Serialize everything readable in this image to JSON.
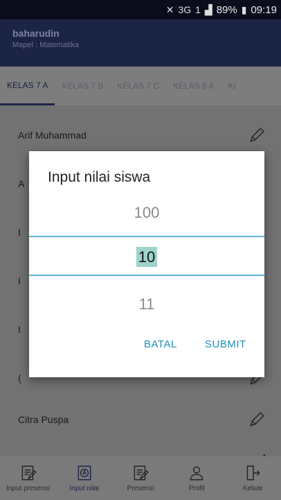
{
  "status_bar": {
    "network": "3G",
    "sim": "1",
    "battery": "89%",
    "time": "09:19"
  },
  "header": {
    "name": "baharudin",
    "subject": "Mapel : Matematika"
  },
  "tabs": [
    {
      "label": "KELAS 7 A"
    },
    {
      "label": "KELAS 7 B"
    },
    {
      "label": "KELAS 7 C"
    },
    {
      "label": "KELAS 8 A"
    },
    {
      "label": "KI"
    }
  ],
  "students": [
    {
      "name": "Arif Muhammad"
    },
    {
      "name": "A"
    },
    {
      "name": "I"
    },
    {
      "name": "I"
    },
    {
      "name": "I"
    },
    {
      "name": "("
    },
    {
      "name": "Citra Puspa"
    }
  ],
  "dialog": {
    "title": "Input nilai siswa",
    "prev_value": "100",
    "selected_value": "10",
    "next_value": "11",
    "cancel_label": "BATAL",
    "submit_label": "SUBMIT"
  },
  "bottom_nav": [
    {
      "label": "Input presensi",
      "icon": "clipboard-edit-icon"
    },
    {
      "label": "Input nilai",
      "icon": "grade-badge-icon"
    },
    {
      "label": "Presensi",
      "icon": "clipboard-icon"
    },
    {
      "label": "Profil",
      "icon": "person-icon"
    },
    {
      "label": "Keluar",
      "icon": "logout-icon"
    }
  ],
  "colors": {
    "header": "#1c2446",
    "accent": "#1b8fb8",
    "picker_line": "#5fb3d8",
    "selection": "#9fd3cd"
  }
}
